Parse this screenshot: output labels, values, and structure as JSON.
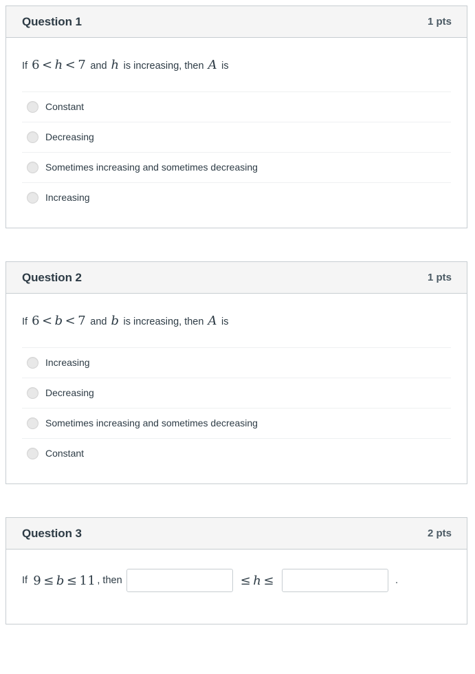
{
  "quiz": {
    "questions": [
      {
        "name": "Question 1",
        "points": "1 pts",
        "prompt": {
          "lead": "If",
          "math1_left": "6",
          "math1_op1": "<",
          "math1_var": "h",
          "math1_op2": "<",
          "math1_right": "7",
          "mid": "and",
          "math2_var": "h",
          "mid2": "is increasing, then",
          "math3_var": "A",
          "tail": "is"
        },
        "answers": [
          "Constant",
          "Decreasing",
          "Sometimes increasing and sometimes decreasing",
          "Increasing"
        ]
      },
      {
        "name": "Question 2",
        "points": "1 pts",
        "prompt": {
          "lead": "If",
          "math1_left": "6",
          "math1_op1": "<",
          "math1_var": "b",
          "math1_op2": "<",
          "math1_right": "7",
          "mid": "and",
          "math2_var": "b",
          "mid2": "is increasing, then",
          "math3_var": "A",
          "tail": "is"
        },
        "answers": [
          "Increasing",
          "Decreasing",
          "Sometimes increasing and sometimes decreasing",
          "Constant"
        ]
      },
      {
        "name": "Question 3",
        "points": "2 pts",
        "fill_in_blank": {
          "lead": "If",
          "math_left": "9",
          "math_op1": "≤",
          "math_var": "b",
          "math_op2": "≤",
          "math_right": "11",
          "comma_then": ", then",
          "input1_value": "",
          "input1_placeholder": "",
          "mid_op1": "≤",
          "mid_var": "h",
          "mid_op2": "≤",
          "input2_value": "",
          "input2_placeholder": "",
          "period": "."
        }
      }
    ]
  },
  "colors": {
    "header_bg": "#f5f5f5",
    "border": "#c7cdd1",
    "text": "#2d3b45",
    "divider": "#eef0f1",
    "radio_fill": "#e8e8e8"
  }
}
